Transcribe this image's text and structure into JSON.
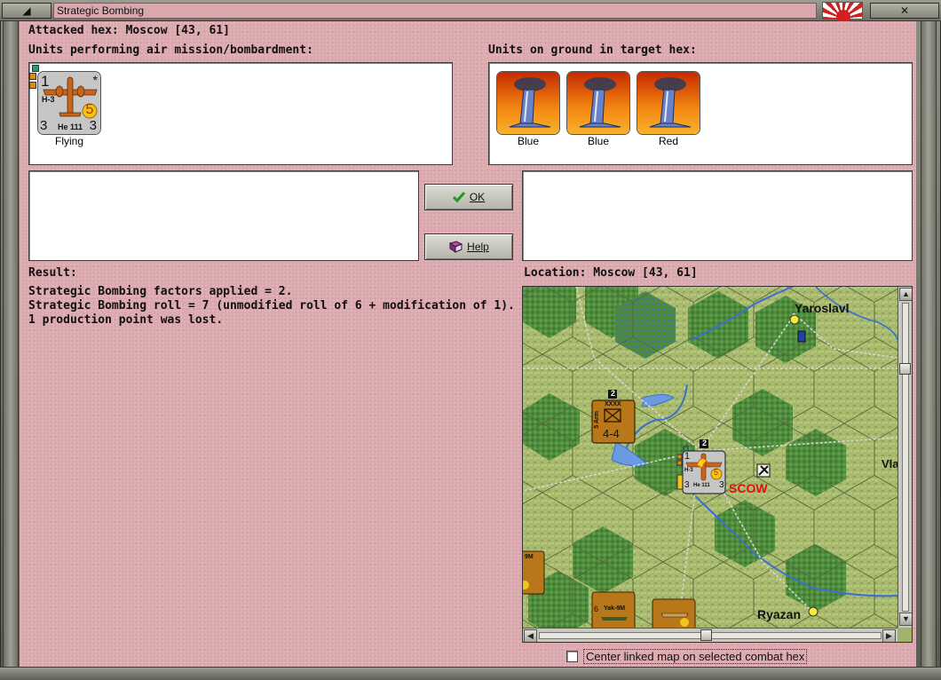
{
  "window": {
    "title": "Strategic Bombing",
    "minimize_glyph": "◢",
    "close_glyph": "✕",
    "flag_icon": "rising-sun-flag-icon"
  },
  "header": {
    "attacked_hex": "Attacked hex: Moscow  [43, 61]",
    "air_units_label": "Units performing air mission/bombardment:",
    "ground_units_label": "Units on ground in target hex:"
  },
  "air_units": [
    {
      "type": "He 111",
      "code": "H-3",
      "top_value": "1",
      "left_value": "3",
      "right_value": "3",
      "circle_value": "5",
      "star": "*",
      "status": "Flying"
    }
  ],
  "ground_units": [
    {
      "type": "factory",
      "label": "Blue"
    },
    {
      "type": "factory",
      "label": "Blue"
    },
    {
      "type": "factory",
      "label": "Red"
    }
  ],
  "buttons": {
    "ok_label": "OK",
    "help_label": "Help"
  },
  "result": {
    "label": "Result:",
    "lines": [
      "Strategic Bombing factors applied = 2.",
      "Strategic Bombing roll = 7 (unmodified roll of 6 + modification of 1).",
      "1 production point was lost."
    ]
  },
  "location": {
    "label": "Location:  Moscow  [43, 61]"
  },
  "map": {
    "city_labels": [
      {
        "name": "Yaroslavl"
      },
      {
        "name": "Vla"
      },
      {
        "name": "Ryazan"
      },
      {
        "name": "SCOW"
      }
    ],
    "counters": {
      "army": {
        "top": "2",
        "corps": "XXXX",
        "strength": "4-4",
        "side_text": "5 Arm"
      },
      "bomber": {
        "top": "2",
        "code": "H-3",
        "circle": "5",
        "left": "3",
        "right": "3",
        "type": "He 111",
        "first": "1"
      },
      "fighter_1": {
        "label": "Yak-9M",
        "num": "6"
      },
      "fighter_2": {
        "label": "9M"
      }
    }
  },
  "footer": {
    "center_map_label": "Center linked map on selected combat hex",
    "center_map_checked": false
  },
  "colors": {
    "client_bg": "#dba9ae",
    "title_field": "#d9a8ad",
    "counter_orange": "#b87718",
    "bomber_gray": "#c6c6c6",
    "city_red": "#e01010"
  }
}
